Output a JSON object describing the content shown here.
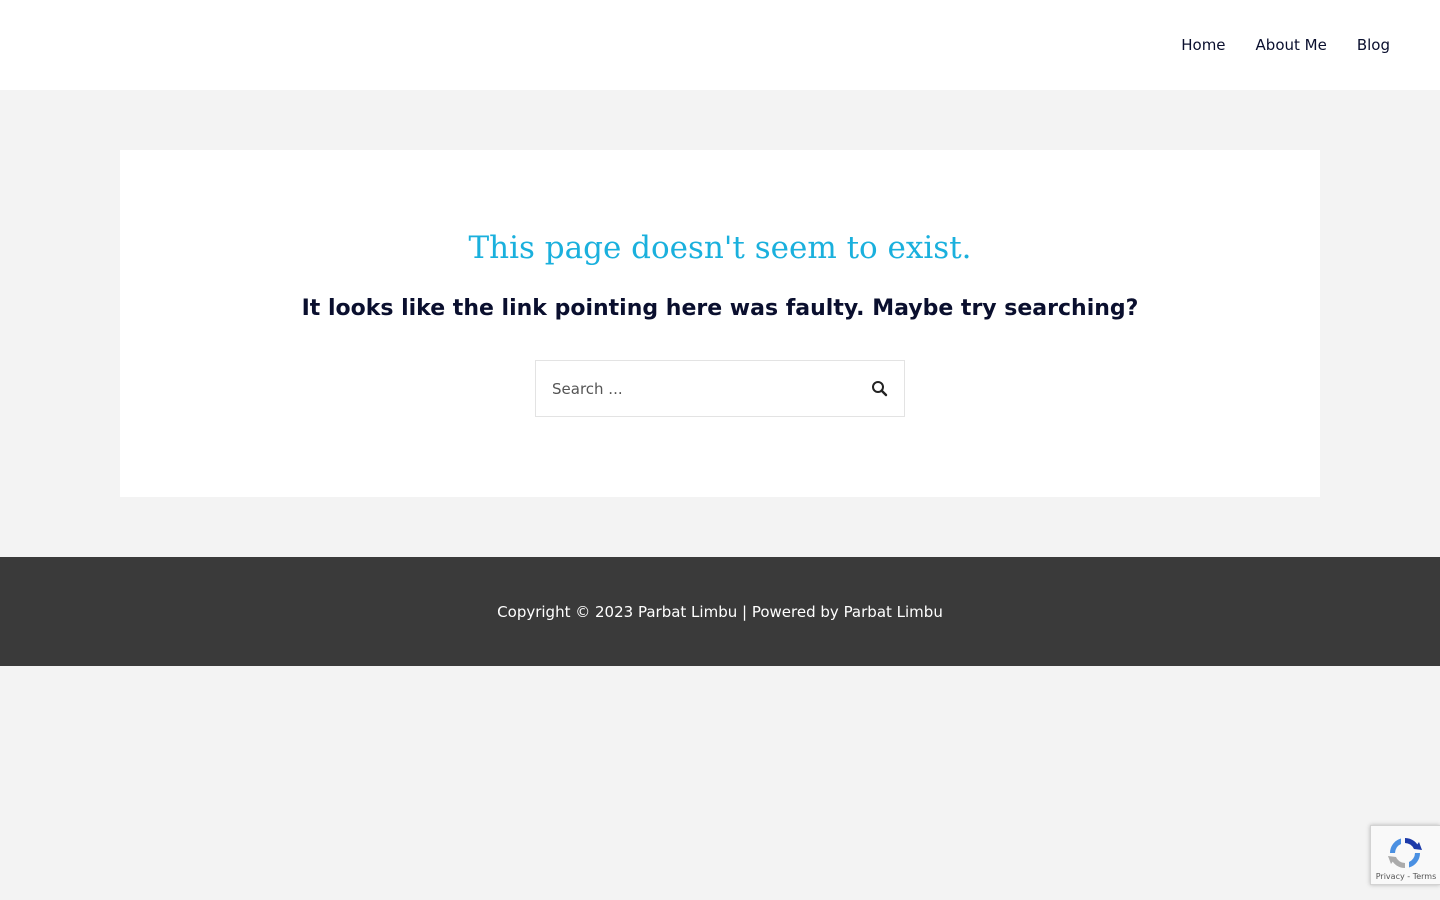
{
  "nav": {
    "items": [
      {
        "label": "Home"
      },
      {
        "label": "About Me"
      },
      {
        "label": "Blog"
      }
    ]
  },
  "main": {
    "title": "This page doesn't seem to exist.",
    "subtitle": "It looks like the link pointing here was faulty. Maybe try searching?",
    "search": {
      "placeholder": "Search ...",
      "value": ""
    }
  },
  "footer": {
    "copyright_prefix": "Copyright © 2023",
    "site_name": "Parbat Limbu",
    "separator": "| Powered by",
    "powered_by": "Parbat Limbu"
  },
  "recaptcha": {
    "privacy_label": "Privacy",
    "separator": "-",
    "terms_label": "Terms"
  },
  "colors": {
    "title": "#1ab0dd",
    "text": "#0a0f2e",
    "footer_bg": "#3a3a3a",
    "page_bg": "#f3f3f3"
  }
}
